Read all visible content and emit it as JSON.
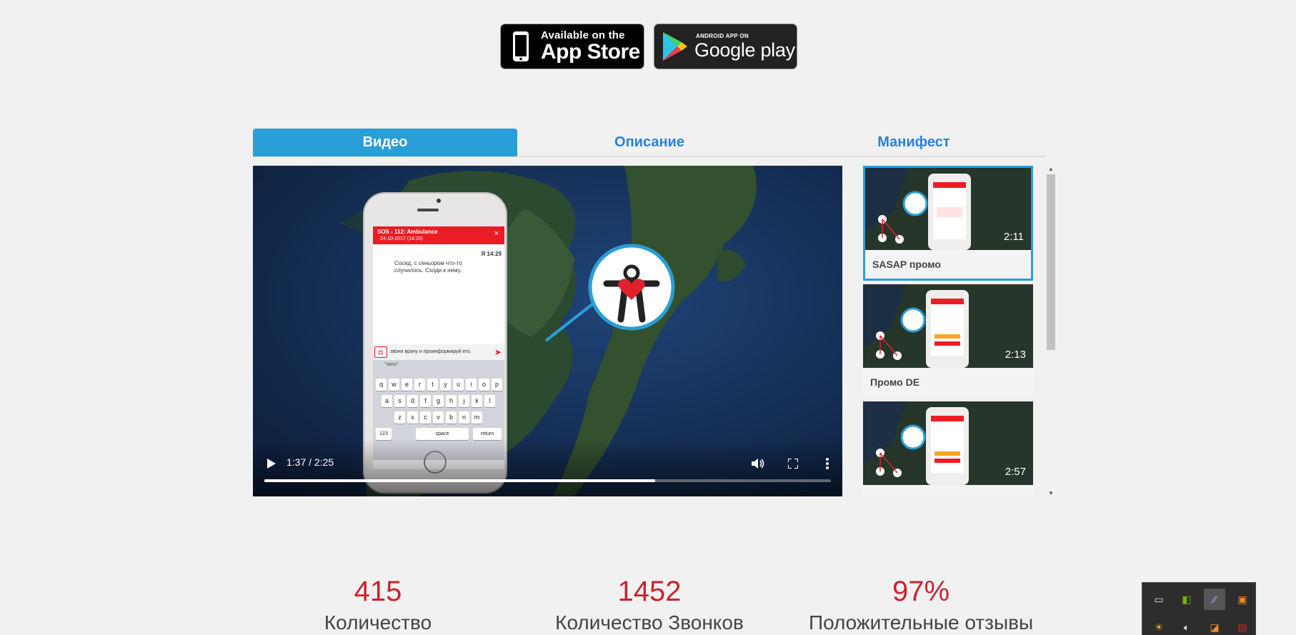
{
  "store_badges": {
    "appstore": {
      "small": "Available on the",
      "big": "App Store",
      "icon": "apple-icon"
    },
    "gplay": {
      "small": "ANDROID APP ON",
      "big": "Google play",
      "icon": "play-triangle-icon"
    }
  },
  "tabs": [
    {
      "label": "Видео",
      "active": true
    },
    {
      "label": "Описание",
      "active": false
    },
    {
      "label": "Манифест",
      "active": false
    }
  ],
  "video": {
    "time": "1:37 / 2:25",
    "progress": 0.69,
    "phone": {
      "header": "SOS - 112: Ambulance",
      "date": "24-10-2017 (14:20)",
      "sender": "Я",
      "msg_time": "14:29",
      "message": "Сосед, с сеньором что-то случилось. Сходи к нему.",
      "input": "звони врачу и проинформируй его.",
      "suggestion": "\"звнu\"",
      "keyboard_row1": [
        "q",
        "w",
        "e",
        "r",
        "t",
        "y",
        "u",
        "i",
        "o",
        "p"
      ],
      "keyboard_row2": [
        "a",
        "s",
        "d",
        "f",
        "g",
        "h",
        "j",
        "k",
        "l"
      ],
      "keyboard_row3": [
        "z",
        "x",
        "c",
        "v",
        "b",
        "n",
        "m"
      ],
      "key_123": "123",
      "key_space": "space",
      "key_return": "return"
    }
  },
  "playlist": [
    {
      "title": "SASAP промо",
      "duration": "2:11",
      "active": true
    },
    {
      "title": "Промо DE",
      "duration": "2:13",
      "active": false
    },
    {
      "title": "",
      "duration": "2:57",
      "active": false
    }
  ],
  "stats": [
    {
      "value": "415",
      "label": "Количество"
    },
    {
      "value": "1452",
      "label": "Количество Звонков"
    },
    {
      "value": "97%",
      "label": "Положительные отзывы"
    }
  ],
  "colors": {
    "accent": "#2a9ed6",
    "tab_link": "#2a82d8",
    "stat_red": "#c8242e"
  }
}
